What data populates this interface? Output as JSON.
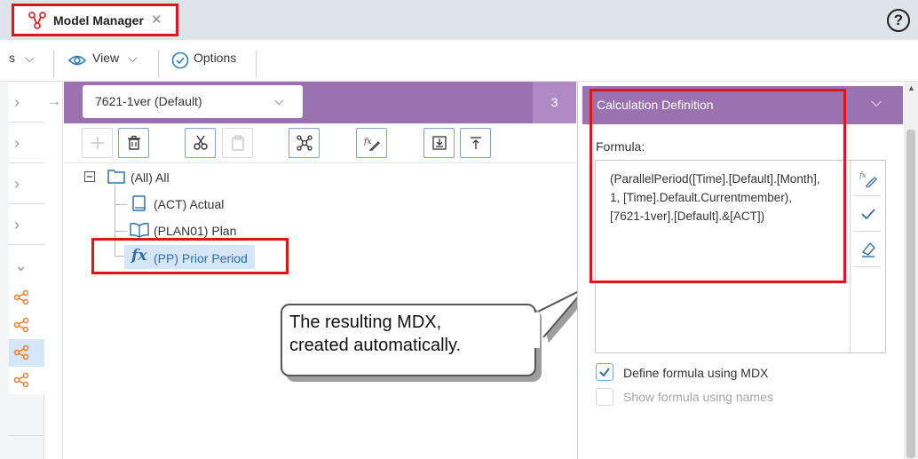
{
  "tab": {
    "title": "Model Manager",
    "close": "✕"
  },
  "help": "?",
  "toolbar": {
    "cut_label": "s",
    "view_label": "View",
    "options_label": "Options"
  },
  "version_select": {
    "value": "7621-1ver (Default)"
  },
  "version_count": "3",
  "tree": {
    "root": "(All) All",
    "items": [
      "(ACT) Actual",
      "(PLAN01) Plan",
      "(PP) Prior Period"
    ]
  },
  "callout": {
    "line1": "The resulting MDX,",
    "line2": "created automatically."
  },
  "calc": {
    "header": "Calculation Definition",
    "formula_label": "Formula:",
    "formula_line1": "(ParallelPeriod([Time].[Default].[Month],",
    "formula_line2": "1, [Time].Default.Currentmember),",
    "formula_line3": "[7621-1ver].[Default].&[ACT])",
    "define_mdx": "Define formula using MDX",
    "show_names": "Show formula using names"
  },
  "colors": {
    "accent_purple": "#9b72b0",
    "highlight_red": "#e0141b",
    "share_orange": "#f07d2b",
    "select_blue": "#d4e6f7"
  }
}
